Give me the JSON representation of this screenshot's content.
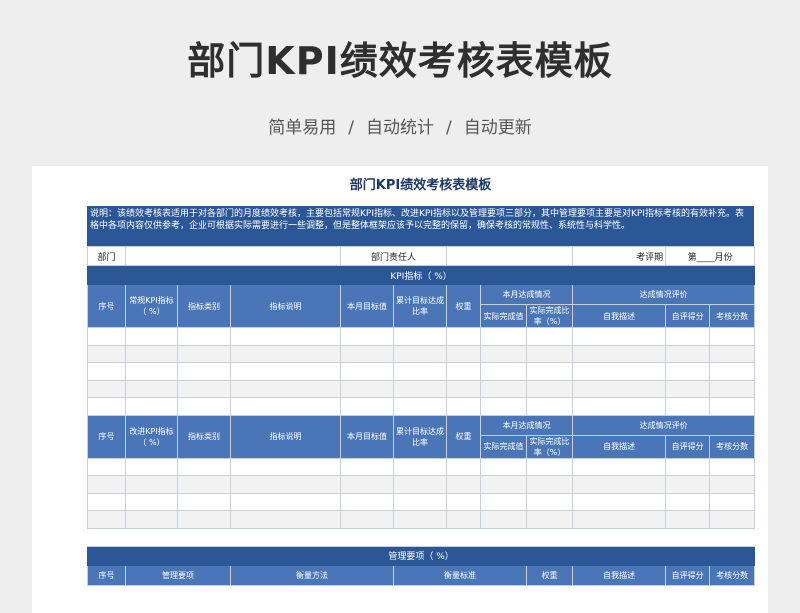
{
  "hero": {
    "title": "部门KPI绩效考核表模板",
    "tag1": "简单易用",
    "tag2": "自动统计",
    "tag3": "自动更新",
    "separator": "/"
  },
  "sheet": {
    "title": "部门KPI绩效考核表模板",
    "description": "说明：该绩效考核表适用于对各部门的月度绩效考核，主要包括常规KPI指标、改进KPI指标以及管理要项三部分，其中管理要项主要是对KPI指标考核的有效补充。表格中各项内容仅供参考，企业可根据实际需要进行一些调整，但是整体框架应该予以完整的保留，确保考核的常规性、系统性与科学性。",
    "info": {
      "dept_label": "部门",
      "dept_value": "",
      "owner_label": "部门责任人",
      "owner_value": "",
      "period_label": "考评期",
      "period_value": "第____月份"
    },
    "kpi_band": "KPI指标（        %）",
    "kpi_table": {
      "seq": "序号",
      "regular_kpi": "常规KPI指标（  %）",
      "category": "指标类别",
      "explain": "指标说明",
      "target": "本月目标值",
      "cum_rate": "累计目标达成比率",
      "weight": "权重",
      "achieve_group": "本月达成情况",
      "actual": "实际完成值",
      "actual_rate": "实际完成比率（%）",
      "eval_group": "达成情况评价",
      "self_desc": "自我描述",
      "self_score": "自评得分",
      "review_score": "考核分数"
    },
    "improve_table": {
      "seq": "序号",
      "improve_kpi": "改进KPI指标（  %）",
      "category": "指标类别",
      "explain": "指标说明",
      "target": "本月目标值",
      "cum_rate": "累计目标达成比率",
      "weight": "权重",
      "achieve_group": "本月达成情况",
      "actual": "实际完成值",
      "actual_rate": "实际完成比率（%）",
      "eval_group": "达成情况评价",
      "self_desc": "自我描述",
      "self_score": "自评得分",
      "review_score": "考核分数"
    },
    "mgmt_band": "管理要项（        %）",
    "mgmt_table": {
      "seq": "序号",
      "item": "管理要项",
      "method": "衡量方法",
      "standard": "衡量标准",
      "weight": "权重",
      "self_desc": "自我描述",
      "self_score": "自评得分",
      "review_score": "考核分数"
    }
  }
}
